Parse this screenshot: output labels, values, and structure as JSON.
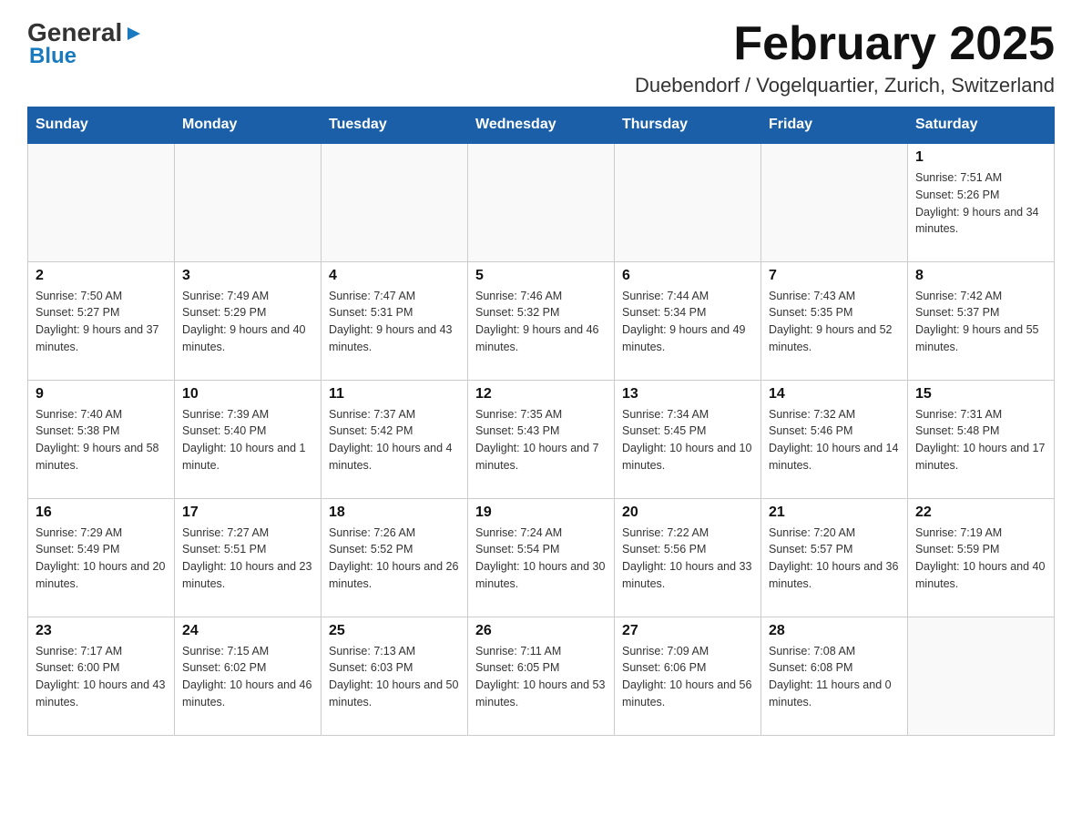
{
  "logo": {
    "line1": "General",
    "line2": "Blue"
  },
  "title": "February 2025",
  "subtitle": "Duebendorf / Vogelquartier, Zurich, Switzerland",
  "days_of_week": [
    "Sunday",
    "Monday",
    "Tuesday",
    "Wednesday",
    "Thursday",
    "Friday",
    "Saturday"
  ],
  "weeks": [
    [
      {
        "day": "",
        "info": ""
      },
      {
        "day": "",
        "info": ""
      },
      {
        "day": "",
        "info": ""
      },
      {
        "day": "",
        "info": ""
      },
      {
        "day": "",
        "info": ""
      },
      {
        "day": "",
        "info": ""
      },
      {
        "day": "1",
        "info": "Sunrise: 7:51 AM\nSunset: 5:26 PM\nDaylight: 9 hours and 34 minutes."
      }
    ],
    [
      {
        "day": "2",
        "info": "Sunrise: 7:50 AM\nSunset: 5:27 PM\nDaylight: 9 hours and 37 minutes."
      },
      {
        "day": "3",
        "info": "Sunrise: 7:49 AM\nSunset: 5:29 PM\nDaylight: 9 hours and 40 minutes."
      },
      {
        "day": "4",
        "info": "Sunrise: 7:47 AM\nSunset: 5:31 PM\nDaylight: 9 hours and 43 minutes."
      },
      {
        "day": "5",
        "info": "Sunrise: 7:46 AM\nSunset: 5:32 PM\nDaylight: 9 hours and 46 minutes."
      },
      {
        "day": "6",
        "info": "Sunrise: 7:44 AM\nSunset: 5:34 PM\nDaylight: 9 hours and 49 minutes."
      },
      {
        "day": "7",
        "info": "Sunrise: 7:43 AM\nSunset: 5:35 PM\nDaylight: 9 hours and 52 minutes."
      },
      {
        "day": "8",
        "info": "Sunrise: 7:42 AM\nSunset: 5:37 PM\nDaylight: 9 hours and 55 minutes."
      }
    ],
    [
      {
        "day": "9",
        "info": "Sunrise: 7:40 AM\nSunset: 5:38 PM\nDaylight: 9 hours and 58 minutes."
      },
      {
        "day": "10",
        "info": "Sunrise: 7:39 AM\nSunset: 5:40 PM\nDaylight: 10 hours and 1 minute."
      },
      {
        "day": "11",
        "info": "Sunrise: 7:37 AM\nSunset: 5:42 PM\nDaylight: 10 hours and 4 minutes."
      },
      {
        "day": "12",
        "info": "Sunrise: 7:35 AM\nSunset: 5:43 PM\nDaylight: 10 hours and 7 minutes."
      },
      {
        "day": "13",
        "info": "Sunrise: 7:34 AM\nSunset: 5:45 PM\nDaylight: 10 hours and 10 minutes."
      },
      {
        "day": "14",
        "info": "Sunrise: 7:32 AM\nSunset: 5:46 PM\nDaylight: 10 hours and 14 minutes."
      },
      {
        "day": "15",
        "info": "Sunrise: 7:31 AM\nSunset: 5:48 PM\nDaylight: 10 hours and 17 minutes."
      }
    ],
    [
      {
        "day": "16",
        "info": "Sunrise: 7:29 AM\nSunset: 5:49 PM\nDaylight: 10 hours and 20 minutes."
      },
      {
        "day": "17",
        "info": "Sunrise: 7:27 AM\nSunset: 5:51 PM\nDaylight: 10 hours and 23 minutes."
      },
      {
        "day": "18",
        "info": "Sunrise: 7:26 AM\nSunset: 5:52 PM\nDaylight: 10 hours and 26 minutes."
      },
      {
        "day": "19",
        "info": "Sunrise: 7:24 AM\nSunset: 5:54 PM\nDaylight: 10 hours and 30 minutes."
      },
      {
        "day": "20",
        "info": "Sunrise: 7:22 AM\nSunset: 5:56 PM\nDaylight: 10 hours and 33 minutes."
      },
      {
        "day": "21",
        "info": "Sunrise: 7:20 AM\nSunset: 5:57 PM\nDaylight: 10 hours and 36 minutes."
      },
      {
        "day": "22",
        "info": "Sunrise: 7:19 AM\nSunset: 5:59 PM\nDaylight: 10 hours and 40 minutes."
      }
    ],
    [
      {
        "day": "23",
        "info": "Sunrise: 7:17 AM\nSunset: 6:00 PM\nDaylight: 10 hours and 43 minutes."
      },
      {
        "day": "24",
        "info": "Sunrise: 7:15 AM\nSunset: 6:02 PM\nDaylight: 10 hours and 46 minutes."
      },
      {
        "day": "25",
        "info": "Sunrise: 7:13 AM\nSunset: 6:03 PM\nDaylight: 10 hours and 50 minutes."
      },
      {
        "day": "26",
        "info": "Sunrise: 7:11 AM\nSunset: 6:05 PM\nDaylight: 10 hours and 53 minutes."
      },
      {
        "day": "27",
        "info": "Sunrise: 7:09 AM\nSunset: 6:06 PM\nDaylight: 10 hours and 56 minutes."
      },
      {
        "day": "28",
        "info": "Sunrise: 7:08 AM\nSunset: 6:08 PM\nDaylight: 11 hours and 0 minutes."
      },
      {
        "day": "",
        "info": ""
      }
    ]
  ]
}
